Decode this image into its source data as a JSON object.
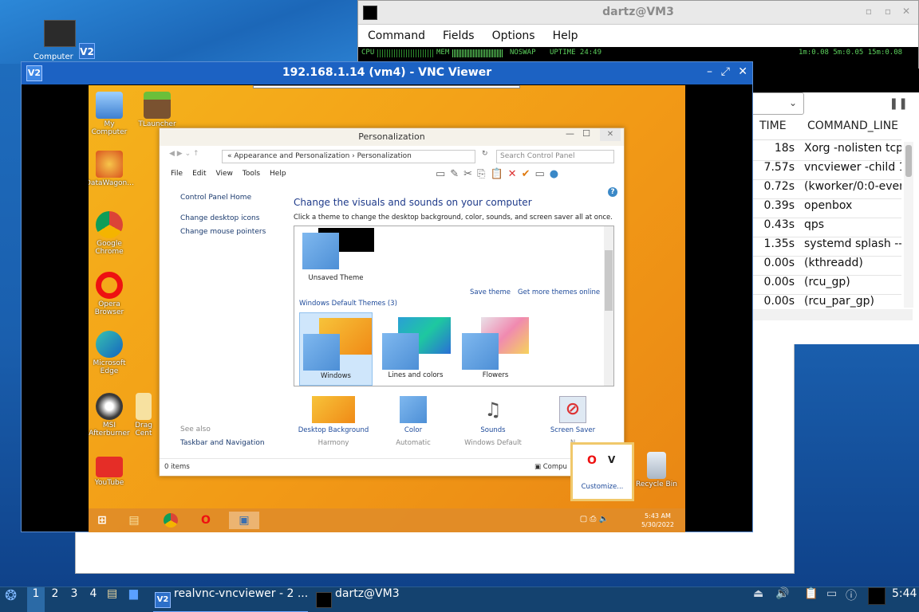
{
  "host": {
    "desktop_icon_label": "Computer",
    "white_window_blank": ""
  },
  "terminal": {
    "title": "dartz@VM3",
    "menu": [
      "Command",
      "Fields",
      "Options",
      "Help"
    ],
    "meters": {
      "cpu": "CPU",
      "mem": "MEM",
      "swap": "NOSWAP",
      "uptime": "UPTIME 24:49",
      "load": "1m:0.08 5m:0.05 15m:0.08"
    },
    "columns": [
      "TIME",
      "COMMAND_LINE"
    ],
    "rows": [
      {
        "time": "18s",
        "cmd": "Xorg -nolisten tcp"
      },
      {
        "time": "7.57s",
        "cmd": "vncviewer -child 1"
      },
      {
        "time": "0.72s",
        "cmd": "(kworker/0:0-ever"
      },
      {
        "time": "0.39s",
        "cmd": "openbox"
      },
      {
        "time": "0.43s",
        "cmd": "qps"
      },
      {
        "time": "1.35s",
        "cmd": "systemd splash --"
      },
      {
        "time": "0.00s",
        "cmd": "(kthreadd)"
      },
      {
        "time": "0.00s",
        "cmd": "(rcu_gp)"
      },
      {
        "time": "0.00s",
        "cmd": "(rcu_par_gp)"
      }
    ]
  },
  "vnc": {
    "title": "192.168.1.14 (vm4) - VNC Viewer",
    "logo": "V2"
  },
  "remote_desktop": {
    "icons": [
      "My Computer",
      "TLauncher",
      "DataWagon...",
      "Google Chrome",
      "Opera Browser",
      "Microsoft Edge",
      "MSI Afterburner",
      "Drag Cent",
      "YouTube",
      "Recycle Bin"
    ]
  },
  "personalization": {
    "title": "Personalization",
    "breadcrumb": [
      "Appearance and Personalization",
      "Personalization"
    ],
    "search_placeholder": "Search Control Panel",
    "menu": [
      "File",
      "Edit",
      "View",
      "Tools",
      "Help"
    ],
    "side_links": [
      "Control Panel Home",
      "Change desktop icons",
      "Change mouse pointers"
    ],
    "see_also_label": "See also",
    "see_also_link": "Taskbar and Navigation",
    "heading": "Change the visuals and sounds on your computer",
    "subheading": "Click a theme to change the desktop background, color, sounds, and screen saver all at once.",
    "unsaved_theme": "Unsaved Theme",
    "save_theme": "Save theme",
    "get_more": "Get more themes online",
    "default_group": "Windows Default Themes (3)",
    "themes": [
      "Windows",
      "Lines and colors",
      "Flowers"
    ],
    "bottom_items": [
      {
        "label": "Desktop Background",
        "value": "Harmony"
      },
      {
        "label": "Color",
        "value": "Automatic"
      },
      {
        "label": "Sounds",
        "value": "Windows Default"
      },
      {
        "label": "Screen Saver",
        "value": "N"
      }
    ],
    "status_items": "0 items",
    "status_right": "Compu"
  },
  "popup": {
    "customize": "Customize..."
  },
  "remote_taskbar": {
    "time": "5:43 AM",
    "date": "5/30/2022"
  },
  "taskbar": {
    "workspaces": [
      "1",
      "2",
      "3",
      "4"
    ],
    "tasks": [
      {
        "label": "realvnc-vncviewer - 2 ..."
      },
      {
        "label": "dartz@VM3"
      }
    ],
    "clock": "5:44"
  },
  "colors": {
    "host_bg": "#1a5fae",
    "vnc_title": "#1c62c3",
    "taskbar": "#14426f",
    "remote_orange": "#f29a16"
  }
}
